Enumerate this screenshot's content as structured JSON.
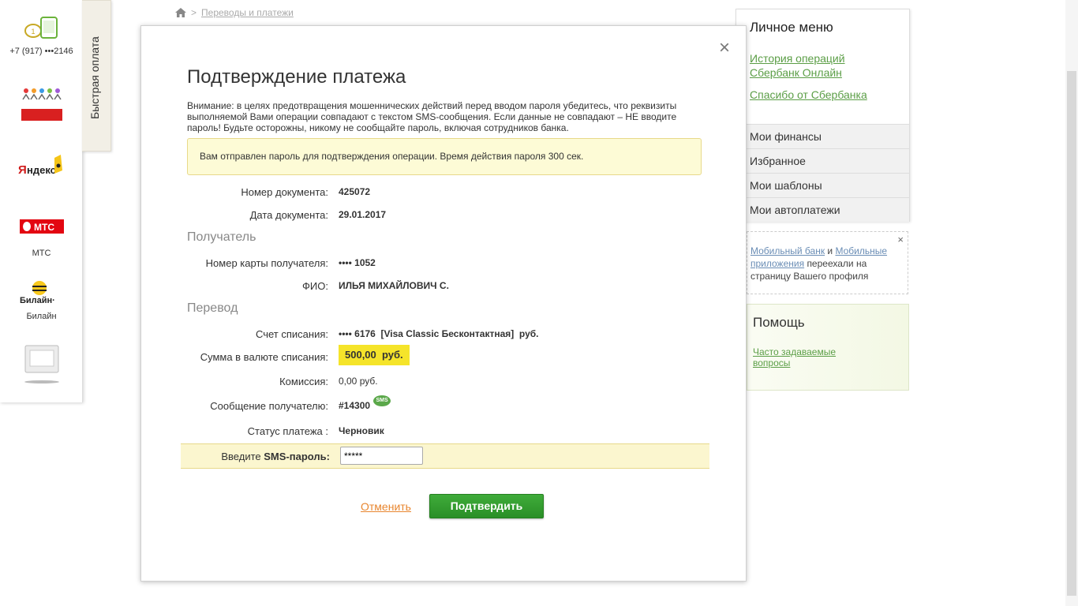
{
  "quickpay": {
    "tab_label": "Быстрая оплата",
    "phone": "+7 (917) •••2146",
    "items": [
      {
        "label": ""
      },
      {
        "label": ""
      },
      {
        "label": "МТС"
      },
      {
        "label": "Билайн"
      },
      {
        "label": ""
      }
    ],
    "logo_yandex": "Яндекс",
    "logo_mts": "МТС",
    "logo_beeline": "Билайн"
  },
  "breadcrumb": {
    "current": "Переводы и платежи"
  },
  "right_menu": {
    "title": "Личное меню",
    "links": [
      "История операций Сбербанк Онлайн",
      "Спасибо от Сбербанка"
    ],
    "items": [
      "Мои финансы",
      "Избранное",
      "Мои шаблоны",
      "Мои автоплатежи"
    ]
  },
  "notice": {
    "link1": "Мобильный банк",
    "and": "и",
    "link2": "Мобильные приложения",
    "rest": "переехали на страницу Вашего профиля",
    "close": "×"
  },
  "help": {
    "title": "Помощь",
    "link": "Часто задаваемые вопросы"
  },
  "modal": {
    "close": "×",
    "title": "Подтверждение платежа",
    "warning": "Внимание: в целях предотвращения мошеннических действий перед вводом пароля убедитесь, что реквизиты выполняемой Вами операции совпадают с текстом SMS-сообщения. Если данные не совпадают – НЕ вводите пароль! Будьте осторожны, никому не сообщайте пароль, включая сотрудников банка.",
    "alert": "Вам отправлен пароль для подтверждения операции. Время действия пароля 300 сек.",
    "doc_number_label": "Номер документа:",
    "doc_number": "425072",
    "doc_date_label": "Дата документа:",
    "doc_date": "29.01.2017",
    "section_recipient": "Получатель",
    "card_label": "Номер карты получателя:",
    "card_value": "•••• 1052",
    "name_label": "ФИО:",
    "name_value": "ИЛЬЯ МИХАЙЛОВИЧ С.",
    "section_transfer": "Перевод",
    "account_label": "Счет списания:",
    "account_value": "•••• 6176  [Visa Classic Бесконтактная]  руб.",
    "amount_label": "Сумма в валюте списания:",
    "amount_value": "500,00  руб.",
    "fee_label": "Комиссия:",
    "fee_value": "0,00 руб.",
    "message_label": "Сообщение получателю:",
    "message_value": "#14300",
    "sms_badge": "SMS",
    "status_label": "Статус платежа :",
    "status_value": "Черновик",
    "sms_label_prefix": "Введите",
    "sms_label_bold": "SMS-пароль:",
    "sms_value": "*****",
    "cancel": "Отменить",
    "confirm": "Подтвердить"
  },
  "colors": {
    "accent_green": "#5b9e46",
    "button_green": "#2a8f27",
    "highlight_yellow": "#f5e42a",
    "cancel_orange": "#e8862f"
  }
}
